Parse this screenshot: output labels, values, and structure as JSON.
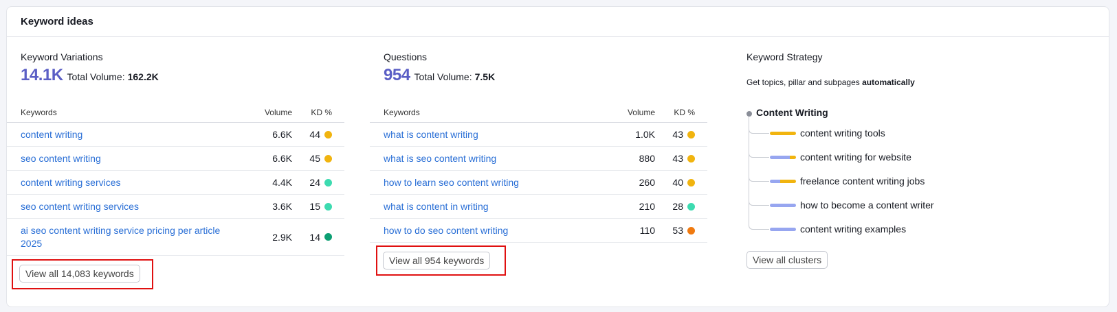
{
  "card": {
    "title": "Keyword ideas"
  },
  "colors": {
    "accent": "#5a5ec5",
    "link": "#2a6fd6",
    "kd_yellow": "#f1b40f",
    "kd_teal": "#3ddbb0",
    "kd_green": "#0c9f73",
    "kd_orange": "#f07a10",
    "bar_blue": "#97a6f0",
    "highlight": "#e01010"
  },
  "variations": {
    "title": "Keyword Variations",
    "count": "14.1K",
    "total_label": "Total Volume:",
    "total_value": "162.2K",
    "headers": {
      "keywords": "Keywords",
      "volume": "Volume",
      "kd": "KD %"
    },
    "rows": [
      {
        "keyword": "content writing",
        "volume": "6.6K",
        "kd": "44",
        "kd_color": "yellow"
      },
      {
        "keyword": "seo content writing",
        "volume": "6.6K",
        "kd": "45",
        "kd_color": "yellow"
      },
      {
        "keyword": "content writing services",
        "volume": "4.4K",
        "kd": "24",
        "kd_color": "teal"
      },
      {
        "keyword": "seo content writing services",
        "volume": "3.6K",
        "kd": "15",
        "kd_color": "teal"
      },
      {
        "keyword": "ai seo content writing service pricing per article 2025",
        "volume": "2.9K",
        "kd": "14",
        "kd_color": "green"
      }
    ],
    "button": "View all 14,083 keywords"
  },
  "questions": {
    "title": "Questions",
    "count": "954",
    "total_label": "Total Volume:",
    "total_value": "7.5K",
    "headers": {
      "keywords": "Keywords",
      "volume": "Volume",
      "kd": "KD %"
    },
    "rows": [
      {
        "keyword": "what is content writing",
        "volume": "1.0K",
        "kd": "43",
        "kd_color": "yellow"
      },
      {
        "keyword": "what is seo content writing",
        "volume": "880",
        "kd": "43",
        "kd_color": "yellow"
      },
      {
        "keyword": "how to learn seo content writing",
        "volume": "260",
        "kd": "40",
        "kd_color": "yellow"
      },
      {
        "keyword": "what is content in writing",
        "volume": "210",
        "kd": "28",
        "kd_color": "teal"
      },
      {
        "keyword": "how to do seo content writing",
        "volume": "110",
        "kd": "53",
        "kd_color": "orange"
      }
    ],
    "button": "View all 954 keywords"
  },
  "strategy": {
    "title": "Keyword Strategy",
    "desc_prefix": "Get topics, pillar and subpages ",
    "desc_bold": "automatically",
    "root": "Content Writing",
    "clusters": [
      {
        "label": "content writing tools",
        "blue_share": 0,
        "yellow_share": 1
      },
      {
        "label": "content writing for website",
        "blue_share": 0.75,
        "yellow_share": 0.25
      },
      {
        "label": "freelance content writing jobs",
        "blue_share": 0.4,
        "yellow_share": 0.6
      },
      {
        "label": "how to become a content writer",
        "blue_share": 1,
        "yellow_share": 0
      },
      {
        "label": "content writing examples",
        "blue_share": 1,
        "yellow_share": 0
      }
    ],
    "button": "View all clusters"
  }
}
